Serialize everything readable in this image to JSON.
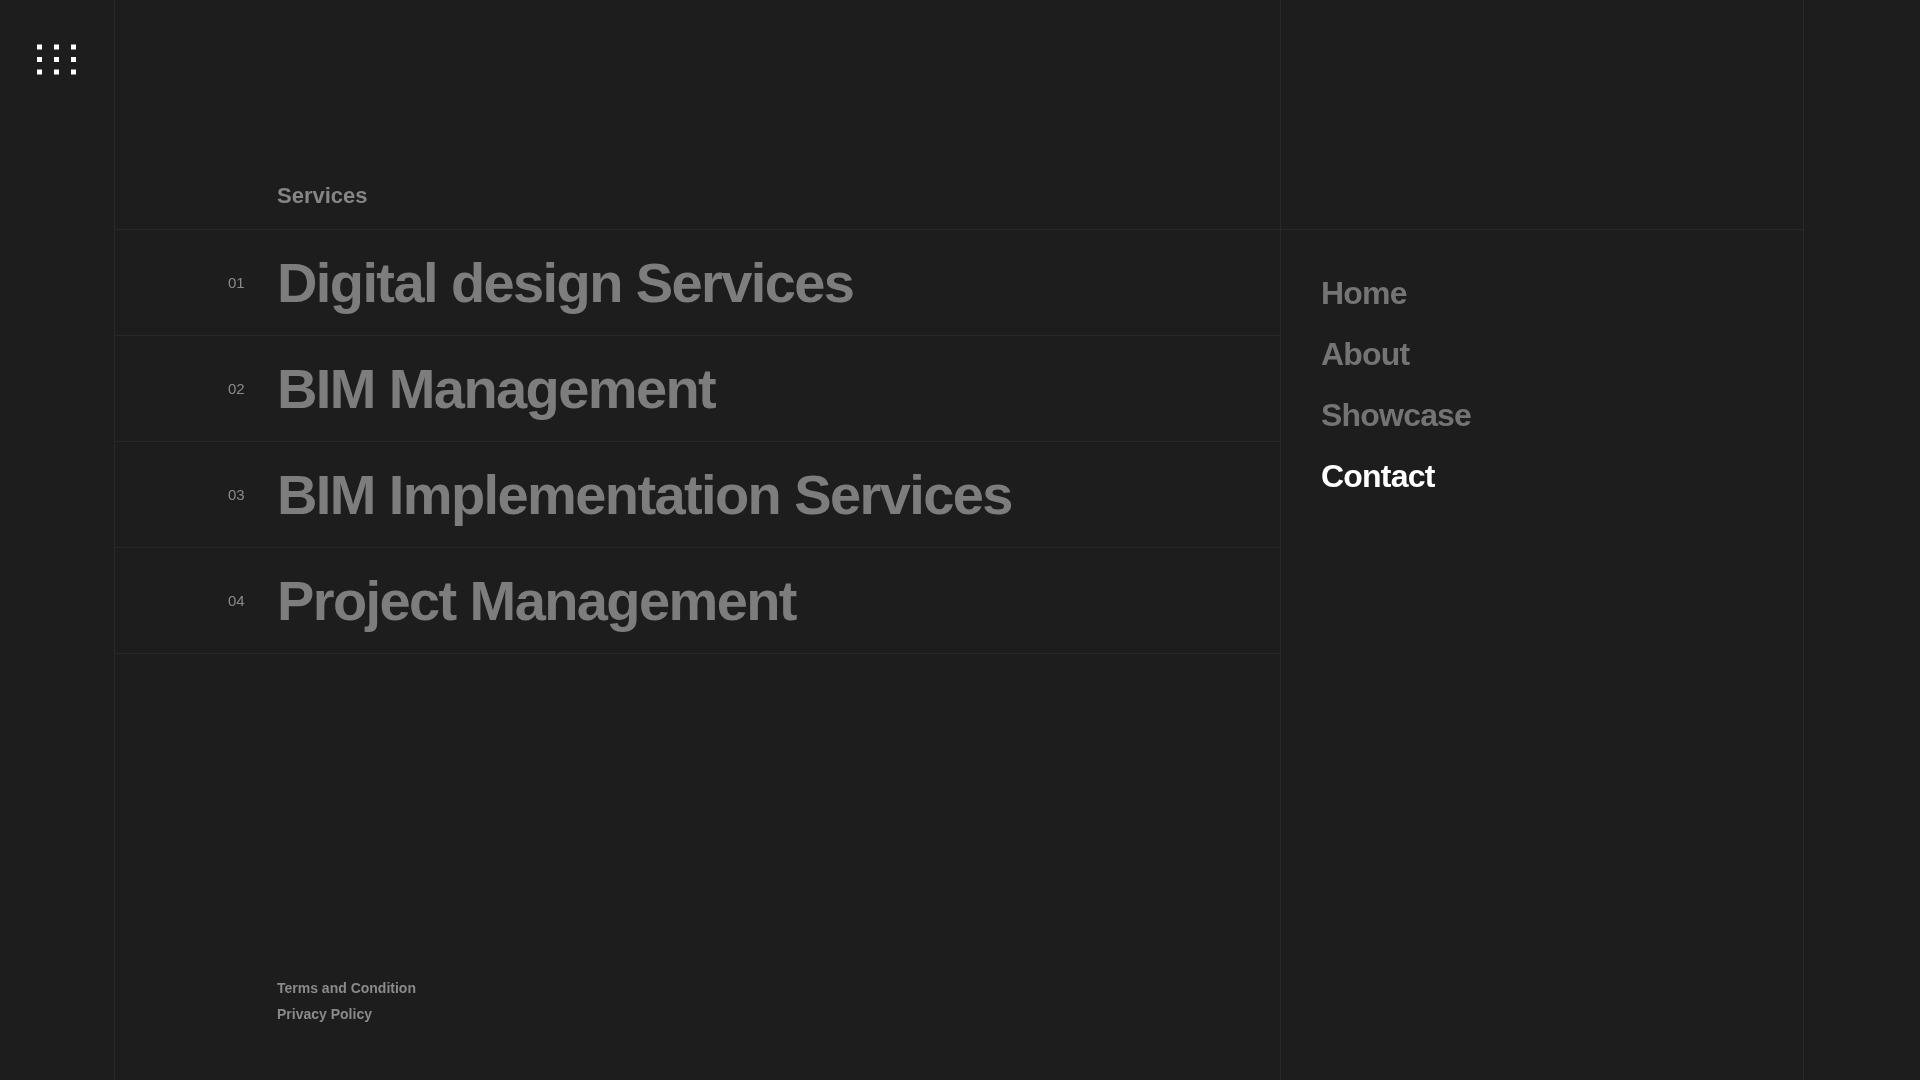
{
  "section_label": "Services",
  "services": [
    {
      "number": "01",
      "title": "Digital design Services"
    },
    {
      "number": "02",
      "title": "BIM Management"
    },
    {
      "number": "03",
      "title": "BIM Implementation Services"
    },
    {
      "number": "04",
      "title": "Project Management"
    }
  ],
  "footer_links": [
    "Terms and Condition",
    "Privacy Policy"
  ],
  "nav": [
    {
      "label": "Home",
      "selected": false
    },
    {
      "label": "About",
      "selected": false
    },
    {
      "label": "Showcase",
      "selected": false
    },
    {
      "label": "Contact",
      "selected": true
    }
  ]
}
